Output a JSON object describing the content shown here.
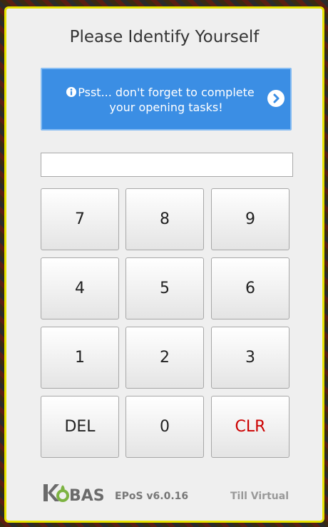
{
  "dialog": {
    "title": "Please Identify Yourself"
  },
  "banner": {
    "message": "Psst... don't forget to complete your opening tasks!",
    "icon": "info-circle-icon",
    "action_icon": "chevron-right-circle-icon",
    "background_color": "#3b8ee4"
  },
  "pin_input": {
    "value": "",
    "placeholder": ""
  },
  "keypad": {
    "keys": [
      "7",
      "8",
      "9",
      "4",
      "5",
      "6",
      "1",
      "2",
      "3",
      "DEL",
      "0",
      "CLR"
    ],
    "clr_color": "#cc0000"
  },
  "footer": {
    "logo_text": "KOBAS",
    "version": "EPoS v6.0.16",
    "till": "Till Virtual"
  },
  "colors": {
    "frame_border": "#e7e300",
    "frame_background": "#efefef"
  }
}
